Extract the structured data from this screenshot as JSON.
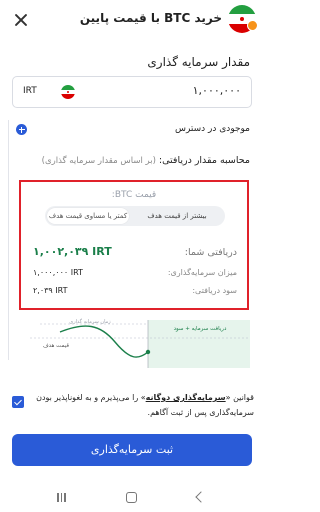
{
  "header": {
    "title": "خرید BTC با قیمت پایین",
    "close_icon": "close-icon"
  },
  "investment": {
    "label": "مقدار سرمایه گذاری",
    "currency": "IRT",
    "amount": "۱,۰۰۰,۰۰۰"
  },
  "balance": {
    "label": "موجودی در دسترس"
  },
  "calc": {
    "label": "محاسبه مقدار دریافتی:",
    "sub": "(بر اساس مقدار سرمایه گذاری)"
  },
  "summary": {
    "price_label": "قیمت BTC:",
    "toggle_active": "کمتر یا مساوی قیمت هدف",
    "toggle_inactive": "بیشتر از قیمت هدف",
    "receive_label": "دریافتی شما:",
    "receive_value": "۱,۰۰۲,۰۳۹ IRT",
    "invest_label": "میزان سرمایه‌گذاری:",
    "invest_value": "۱,۰۰۰,۰۰۰ IRT",
    "profit_label": "سود دریافتی:",
    "profit_value": "۲,۰۳۹ IRT"
  },
  "chart": {
    "target_price_label": "قیمت هدف",
    "receive_label": "دریافت سرمایه + سود",
    "period_label": "زمان سرمایه گذاری"
  },
  "agreement": {
    "prefix": "قوانین «",
    "link": "سرمایه‌گذاری دوگانه",
    "suffix": "» را می‌پذیرم و به لغوناپذیر بودن سرمایه‌گذاری پس از ثبت آگاهم."
  },
  "submit": {
    "label": "ثبت سرمایه‌گذاری"
  },
  "colors": {
    "accent": "#2a5bd7",
    "highlight": "#e0212a",
    "positive": "#1b7f4a"
  }
}
